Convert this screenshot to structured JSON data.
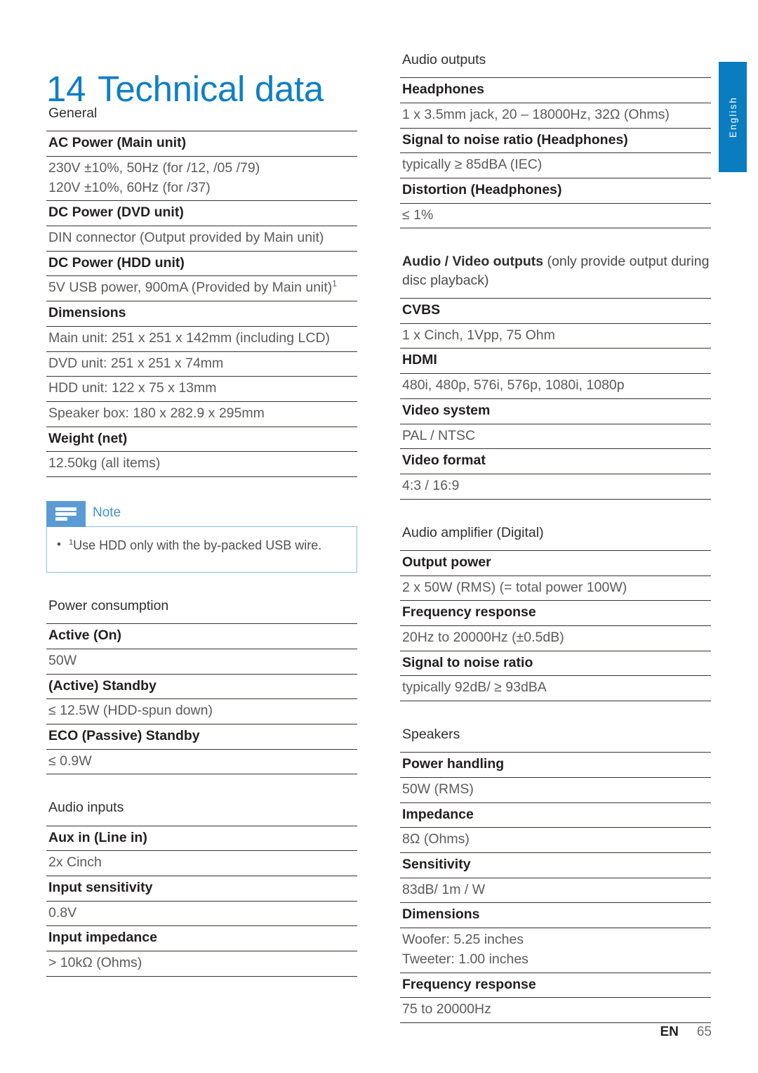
{
  "page": {
    "title_number": "14",
    "title_text": "Technical data",
    "language_tab": "English",
    "footer_lang": "EN",
    "footer_page": "65",
    "accent_blue": "#0f7fc5",
    "note_blue": "#5b9bd5",
    "tab_blue": "#0a7cc0"
  },
  "left_column": {
    "sections": [
      {
        "label": "General",
        "rows": [
          {
            "type": "head",
            "text": "AC Power (Main unit)"
          },
          {
            "type": "val",
            "text": "230V ±10%, 50Hz (for /12, /05 /79)\n120V ±10%, 60Hz (for /37)"
          },
          {
            "type": "head",
            "text": "DC Power (DVD unit)"
          },
          {
            "type": "val",
            "text": "DIN connector (Output provided by Main unit)"
          },
          {
            "type": "head",
            "text": "DC Power (HDD unit)"
          },
          {
            "type": "val",
            "text": "5V USB power, 900mA (Provided by Main unit)",
            "superscript": "1"
          },
          {
            "type": "head",
            "text": "Dimensions"
          },
          {
            "type": "val",
            "text": "Main unit: 251 x 251 x 142mm (including LCD)"
          },
          {
            "type": "val",
            "text": "DVD unit: 251 x 251 x 74mm"
          },
          {
            "type": "val",
            "text": "HDD unit: 122 x 75 x 13mm"
          },
          {
            "type": "val",
            "text": "Speaker box: 180 x 282.9 x 295mm"
          },
          {
            "type": "head",
            "text": "Weight (net)"
          },
          {
            "type": "val",
            "text": "12.50kg (all items)"
          }
        ]
      },
      {
        "label": "Power consumption",
        "rows": [
          {
            "type": "head",
            "text": "Active (On)"
          },
          {
            "type": "val",
            "text": "50W"
          },
          {
            "type": "head",
            "text": "(Active) Standby"
          },
          {
            "type": "val",
            "text": "≤ 12.5W (HDD-spun down)"
          },
          {
            "type": "head",
            "text": "ECO (Passive) Standby"
          },
          {
            "type": "val",
            "text": "≤ 0.9W"
          }
        ]
      },
      {
        "label": "Audio inputs",
        "rows": [
          {
            "type": "head",
            "text": "Aux in (Line in)"
          },
          {
            "type": "val",
            "text": "2x Cinch"
          },
          {
            "type": "head",
            "text": "Input sensitivity"
          },
          {
            "type": "val",
            "text": "0.8V"
          },
          {
            "type": "head",
            "text": "Input impedance"
          },
          {
            "type": "val",
            "text": "> 10kΩ (Ohms)"
          }
        ]
      }
    ],
    "note": {
      "title": "Note",
      "icon": "note-lines-icon",
      "items": [
        {
          "superscript": "1",
          "text": "Use HDD only with the by-packed USB wire."
        }
      ]
    }
  },
  "right_column": {
    "sections": [
      {
        "label": "Audio outputs",
        "rows": [
          {
            "type": "head",
            "text": "Headphones"
          },
          {
            "type": "val",
            "text": "1 x 3.5mm jack, 20 – 18000Hz, 32Ω (Ohms)"
          },
          {
            "type": "head",
            "text": "Signal to noise ratio (Headphones)"
          },
          {
            "type": "val",
            "text": "typically ≥ 85dBA (IEC)"
          },
          {
            "type": "head",
            "text": "Distortion (Headphones)"
          },
          {
            "type": "val",
            "text": "≤ 1%"
          }
        ]
      },
      {
        "label_bold": "Audio / Video outputs",
        "label_light": " (only provide output during disc playback)",
        "rows": [
          {
            "type": "head",
            "text": "CVBS"
          },
          {
            "type": "val",
            "text": "1 x Cinch, 1Vpp, 75 Ohm"
          },
          {
            "type": "head",
            "text": "HDMI"
          },
          {
            "type": "val",
            "text": "480i, 480p, 576i, 576p, 1080i, 1080p"
          },
          {
            "type": "head",
            "text": "Video system"
          },
          {
            "type": "val",
            "text": "PAL / NTSC"
          },
          {
            "type": "head",
            "text": "Video format"
          },
          {
            "type": "val",
            "text": "4:3 / 16:9"
          }
        ]
      },
      {
        "label": "Audio amplifier (Digital)",
        "rows": [
          {
            "type": "head",
            "text": "Output power"
          },
          {
            "type": "val",
            "text": "2 x 50W (RMS) (= total power 100W)"
          },
          {
            "type": "head",
            "text": "Frequency response"
          },
          {
            "type": "val",
            "text": "20Hz to 20000Hz (±0.5dB)"
          },
          {
            "type": "head",
            "text": "Signal to noise ratio"
          },
          {
            "type": "val",
            "text": "typically 92dB/ ≥ 93dBA"
          }
        ]
      },
      {
        "label": "Speakers",
        "rows": [
          {
            "type": "head",
            "text": "Power handling"
          },
          {
            "type": "val",
            "text": "50W (RMS)"
          },
          {
            "type": "head",
            "text": "Impedance"
          },
          {
            "type": "val",
            "text": "8Ω (Ohms)"
          },
          {
            "type": "head",
            "text": "Sensitivity"
          },
          {
            "type": "val",
            "text": "83dB/ 1m / W"
          },
          {
            "type": "head",
            "text": "Dimensions"
          },
          {
            "type": "val",
            "text": "Woofer: 5.25 inches\nTweeter: 1.00 inches"
          },
          {
            "type": "head",
            "text": "Frequency response"
          },
          {
            "type": "val",
            "text": "75 to 20000Hz"
          }
        ]
      }
    ]
  }
}
